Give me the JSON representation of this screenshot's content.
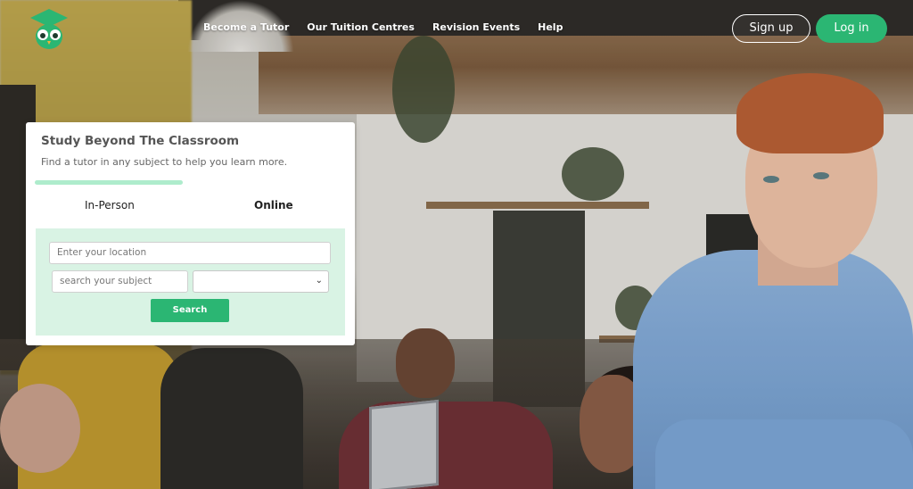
{
  "nav": {
    "logo_icon": "owl-graduation-cap-icon",
    "links": [
      {
        "label": "Become a Tutor"
      },
      {
        "label": "Our Tuition Centres"
      },
      {
        "label": "Revision Events"
      },
      {
        "label": "Help"
      }
    ],
    "signup_label": "Sign up",
    "login_label": "Log in"
  },
  "colors": {
    "brand_green": "#2bb673",
    "panel_green": "#d9f3e4",
    "tab_indicator": "#aeeccc"
  },
  "search_card": {
    "title": "Study Beyond The Classroom",
    "subtitle": "Find a tutor in any subject to help you learn more.",
    "tabs": [
      {
        "label": "In-Person",
        "active": true
      },
      {
        "label": "Online",
        "active": false
      }
    ],
    "location": {
      "placeholder": "Enter your location",
      "value": ""
    },
    "subject": {
      "placeholder": "search your subject",
      "value": ""
    },
    "level_select": {
      "selected": ""
    },
    "search_label": "Search"
  }
}
